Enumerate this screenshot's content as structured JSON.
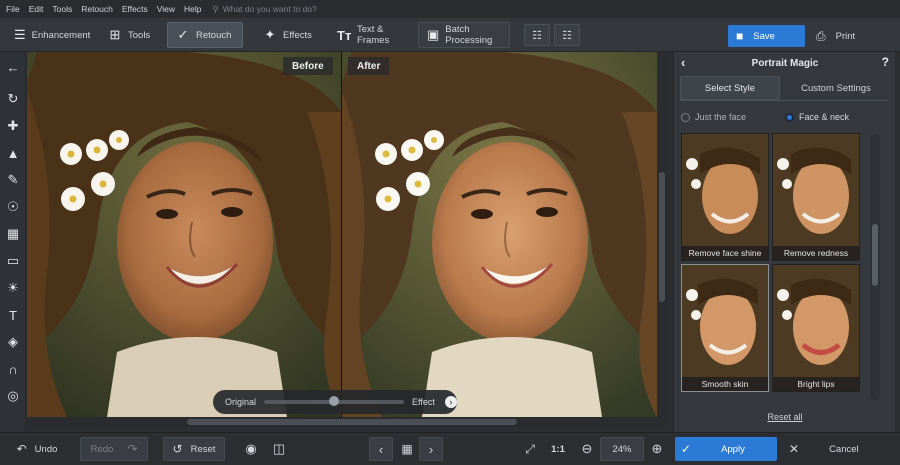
{
  "menu": {
    "items": [
      "File",
      "Edit",
      "Tools",
      "Retouch",
      "Effects",
      "View",
      "Help"
    ],
    "search_placeholder": "What do you want to do?"
  },
  "toolbar": {
    "tabs": [
      {
        "label": "Enhancement",
        "icon": "sliders-icon"
      },
      {
        "label": "Tools",
        "icon": "crop-icon"
      },
      {
        "label": "Retouch",
        "icon": "brush-icon",
        "active": true
      },
      {
        "label": "Effects",
        "icon": "magic-wand-icon"
      },
      {
        "label": "Text & Frames",
        "icon": "text-icon"
      },
      {
        "label": "Batch Processing",
        "icon": "images-icon"
      }
    ],
    "save_label": "Save",
    "print_label": "Print"
  },
  "canvas": {
    "before_label": "Before",
    "after_label": "After",
    "slider": {
      "left_label": "Original",
      "right_label": "Effect",
      "value": 0.5
    }
  },
  "panel": {
    "title": "Portrait Magic",
    "help": "?",
    "tabs": [
      "Select Style",
      "Custom Settings"
    ],
    "active_tab": 0,
    "radio": {
      "options": [
        "Just the face",
        "Face & neck"
      ],
      "selected": 1
    },
    "styles": [
      "Remove face shine",
      "Remove redness",
      "Smooth skin",
      "Bright lips"
    ],
    "reset_all": "Reset all"
  },
  "bottom": {
    "undo": "Undo",
    "redo": "Redo",
    "reset": "Reset",
    "zoom_1to1": "1:1",
    "zoom_percent": "24%",
    "apply": "Apply",
    "cancel": "Cancel"
  },
  "colors": {
    "accent": "#2b7bd6",
    "panel": "#35383d",
    "toolbar": "#34373c"
  }
}
